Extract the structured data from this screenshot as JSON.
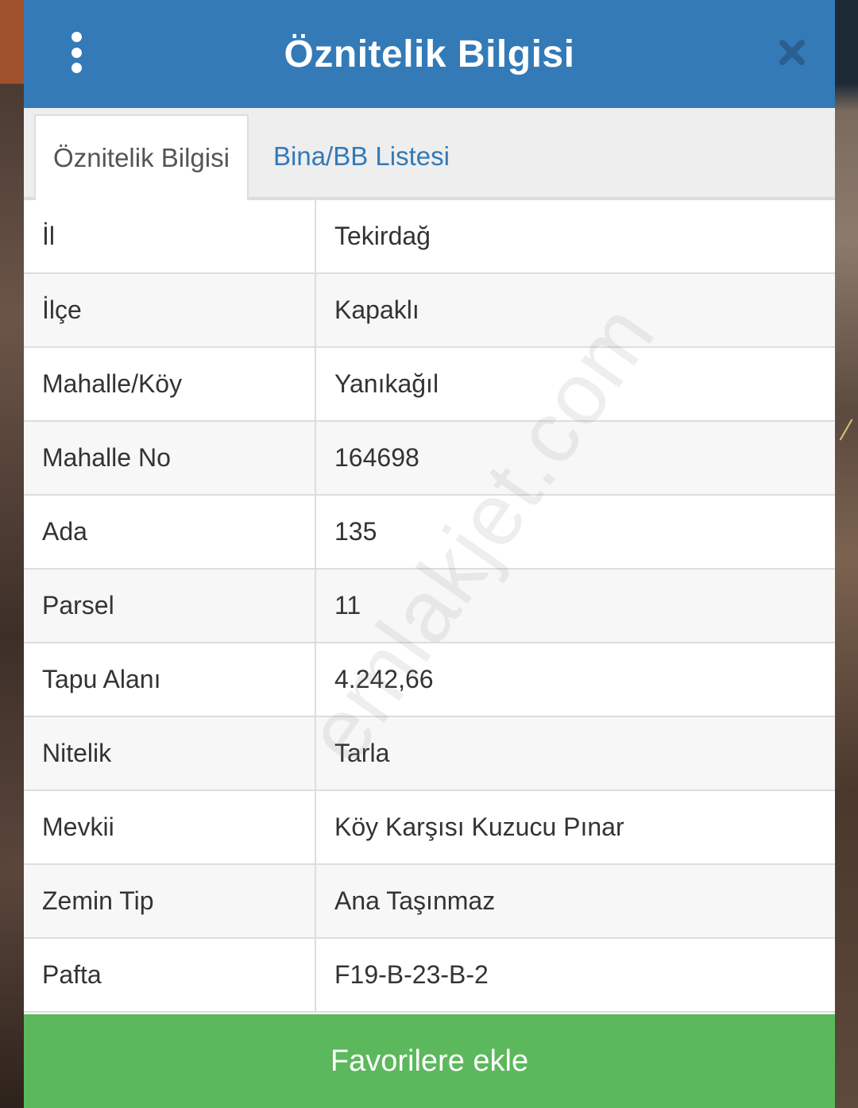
{
  "header": {
    "title": "Öznitelik Bilgisi"
  },
  "tabs": [
    {
      "label": "Öznitelik Bilgisi",
      "active": true
    },
    {
      "label": "Bina/BB Listesi",
      "active": false
    }
  ],
  "attributes": [
    {
      "key": "İl",
      "value": "Tekirdağ"
    },
    {
      "key": "İlçe",
      "value": "Kapaklı"
    },
    {
      "key": "Mahalle/Köy",
      "value": "Yanıkağıl"
    },
    {
      "key": "Mahalle No",
      "value": "164698"
    },
    {
      "key": "Ada",
      "value": "135"
    },
    {
      "key": "Parsel",
      "value": "11"
    },
    {
      "key": "Tapu Alanı",
      "value": "4.242,66"
    },
    {
      "key": "Nitelik",
      "value": "Tarla"
    },
    {
      "key": "Mevkii",
      "value": "Köy Karşısı Kuzucu Pınar"
    },
    {
      "key": "Zemin Tip",
      "value": "Ana Taşınmaz"
    },
    {
      "key": "Pafta",
      "value": "F19-B-23-B-2"
    }
  ],
  "watermark": "emlakjet.com",
  "favorite_button": "Favorilere ekle",
  "colors": {
    "header": "#337ab7",
    "tab_link": "#337ab7",
    "favorite": "#5cb85c"
  },
  "icons": {
    "menu": "kebab-menu-icon",
    "close": "close-icon"
  }
}
